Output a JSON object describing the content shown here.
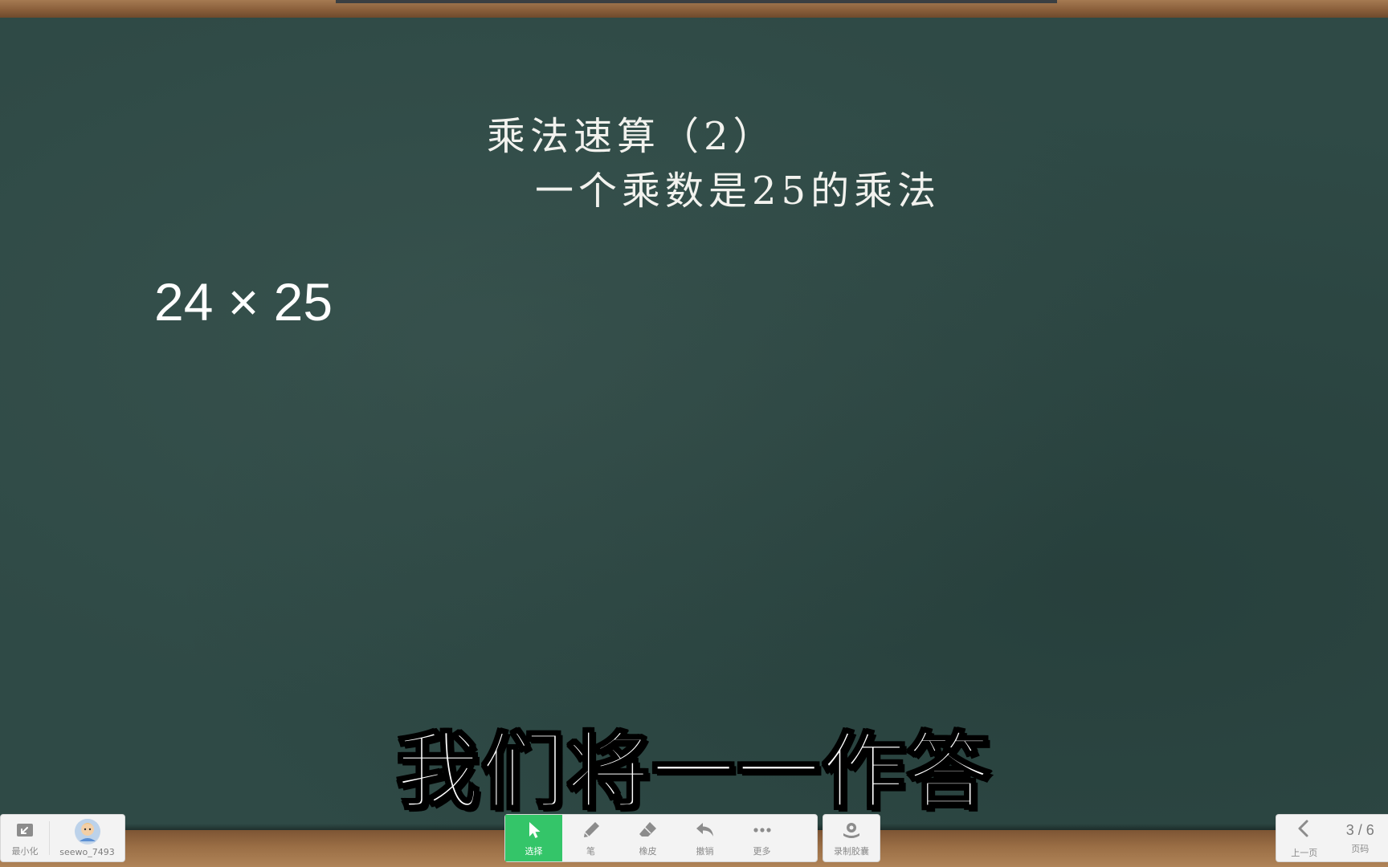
{
  "board": {
    "title": "乘法速算（2）",
    "subtitle": "一个乘数是25的乘法",
    "expression": "24 × 25"
  },
  "caption": "我们将一一作答",
  "toolbar": {
    "left": {
      "minimize_label": "最小化",
      "username": "seewo_7493"
    },
    "center": {
      "tools": [
        {
          "label": "选择",
          "icon": "cursor-icon",
          "active": true
        },
        {
          "label": "笔",
          "icon": "pen-icon",
          "active": false
        },
        {
          "label": "橡皮",
          "icon": "eraser-icon",
          "active": false
        },
        {
          "label": "撤销",
          "icon": "undo-icon",
          "active": false
        },
        {
          "label": "更多",
          "icon": "more-icon",
          "active": false
        }
      ]
    },
    "record": {
      "label": "录制胶囊",
      "icon": "record-capsule-icon"
    },
    "right": {
      "prev_label": "上一页",
      "page_label": "页码",
      "page_indicator": "3 / 6"
    }
  },
  "colors": {
    "board": "#2f4a46",
    "chalk": "#f2f2ee",
    "active_tool": "#34c569",
    "wood": "#8a5f3b"
  }
}
